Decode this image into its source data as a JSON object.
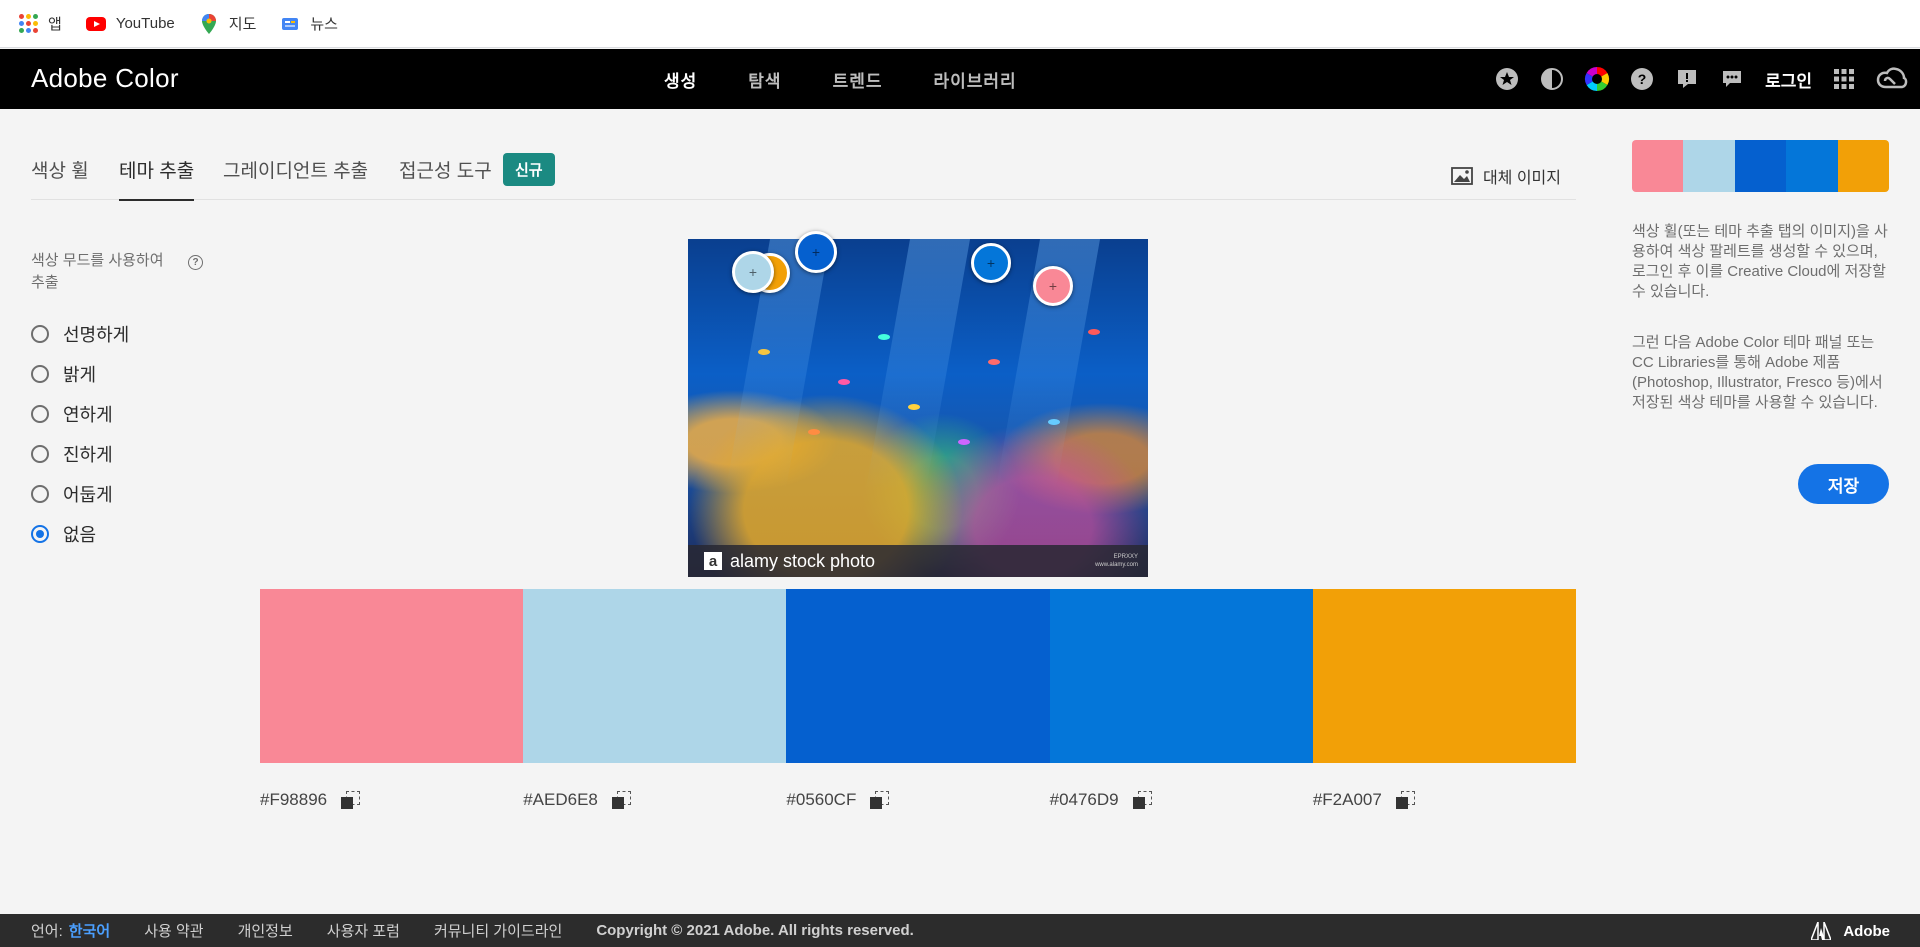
{
  "bookmarks": [
    {
      "label": "앱",
      "icon": "apps-grid-icon"
    },
    {
      "label": "YouTube",
      "icon": "youtube-icon"
    },
    {
      "label": "지도",
      "icon": "maps-pin-icon"
    },
    {
      "label": "뉴스",
      "icon": "news-icon"
    }
  ],
  "header": {
    "logo": "Adobe Color",
    "nav": [
      "생성",
      "탐색",
      "트렌드",
      "라이브러리"
    ],
    "active_nav": "생성",
    "login": "로그인"
  },
  "subtabs": {
    "items": [
      "색상 휠",
      "테마 추출",
      "그레이디언트 추출",
      "접근성 도구"
    ],
    "active": "테마 추출",
    "badge": "신규",
    "alt_image": "대체 이미지"
  },
  "mood": {
    "title": "색상 무드를 사용하여 추출",
    "help_glyph": "?",
    "options": [
      "선명하게",
      "밝게",
      "연하게",
      "진하게",
      "어둡게",
      "없음"
    ],
    "selected": "없음"
  },
  "photo": {
    "watermark_letter": "a",
    "watermark_text": "alamy stock photo",
    "watermark_small_1": "EPRXXY",
    "watermark_small_2": "www.alamy.com"
  },
  "palette": [
    {
      "hex": "#F98896",
      "color": "#F98896"
    },
    {
      "hex": "#AED6E8",
      "color": "#AED6E8"
    },
    {
      "hex": "#0560CF",
      "color": "#0560CF"
    },
    {
      "hex": "#0476D9",
      "color": "#0476D9"
    },
    {
      "hex": "#F2A007",
      "color": "#F2A007"
    }
  ],
  "right_panel": {
    "desc1": "색상 휠(또는 테마 추출 탭의 이미지)을 사용하여 색상 팔레트를 생성할 수 있으며, 로그인 후 이를 Creative Cloud에 저장할 수 있습니다.",
    "desc2": "그런 다음 Adobe Color 테마 패널 또는 CC Libraries를 통해 Adobe 제품(Photoshop, Illustrator, Fresco 등)에서 저장된 색상 테마를 사용할 수 있습니다.",
    "save": "저장"
  },
  "footer": {
    "lang_label": "언어:",
    "lang": "한국어",
    "links": [
      "사용 약관",
      "개인정보",
      "사용자 포럼",
      "커뮤니티 가이드라인"
    ],
    "copyright": "Copyright © 2021 Adobe. All rights reserved.",
    "brand": "Adobe"
  }
}
